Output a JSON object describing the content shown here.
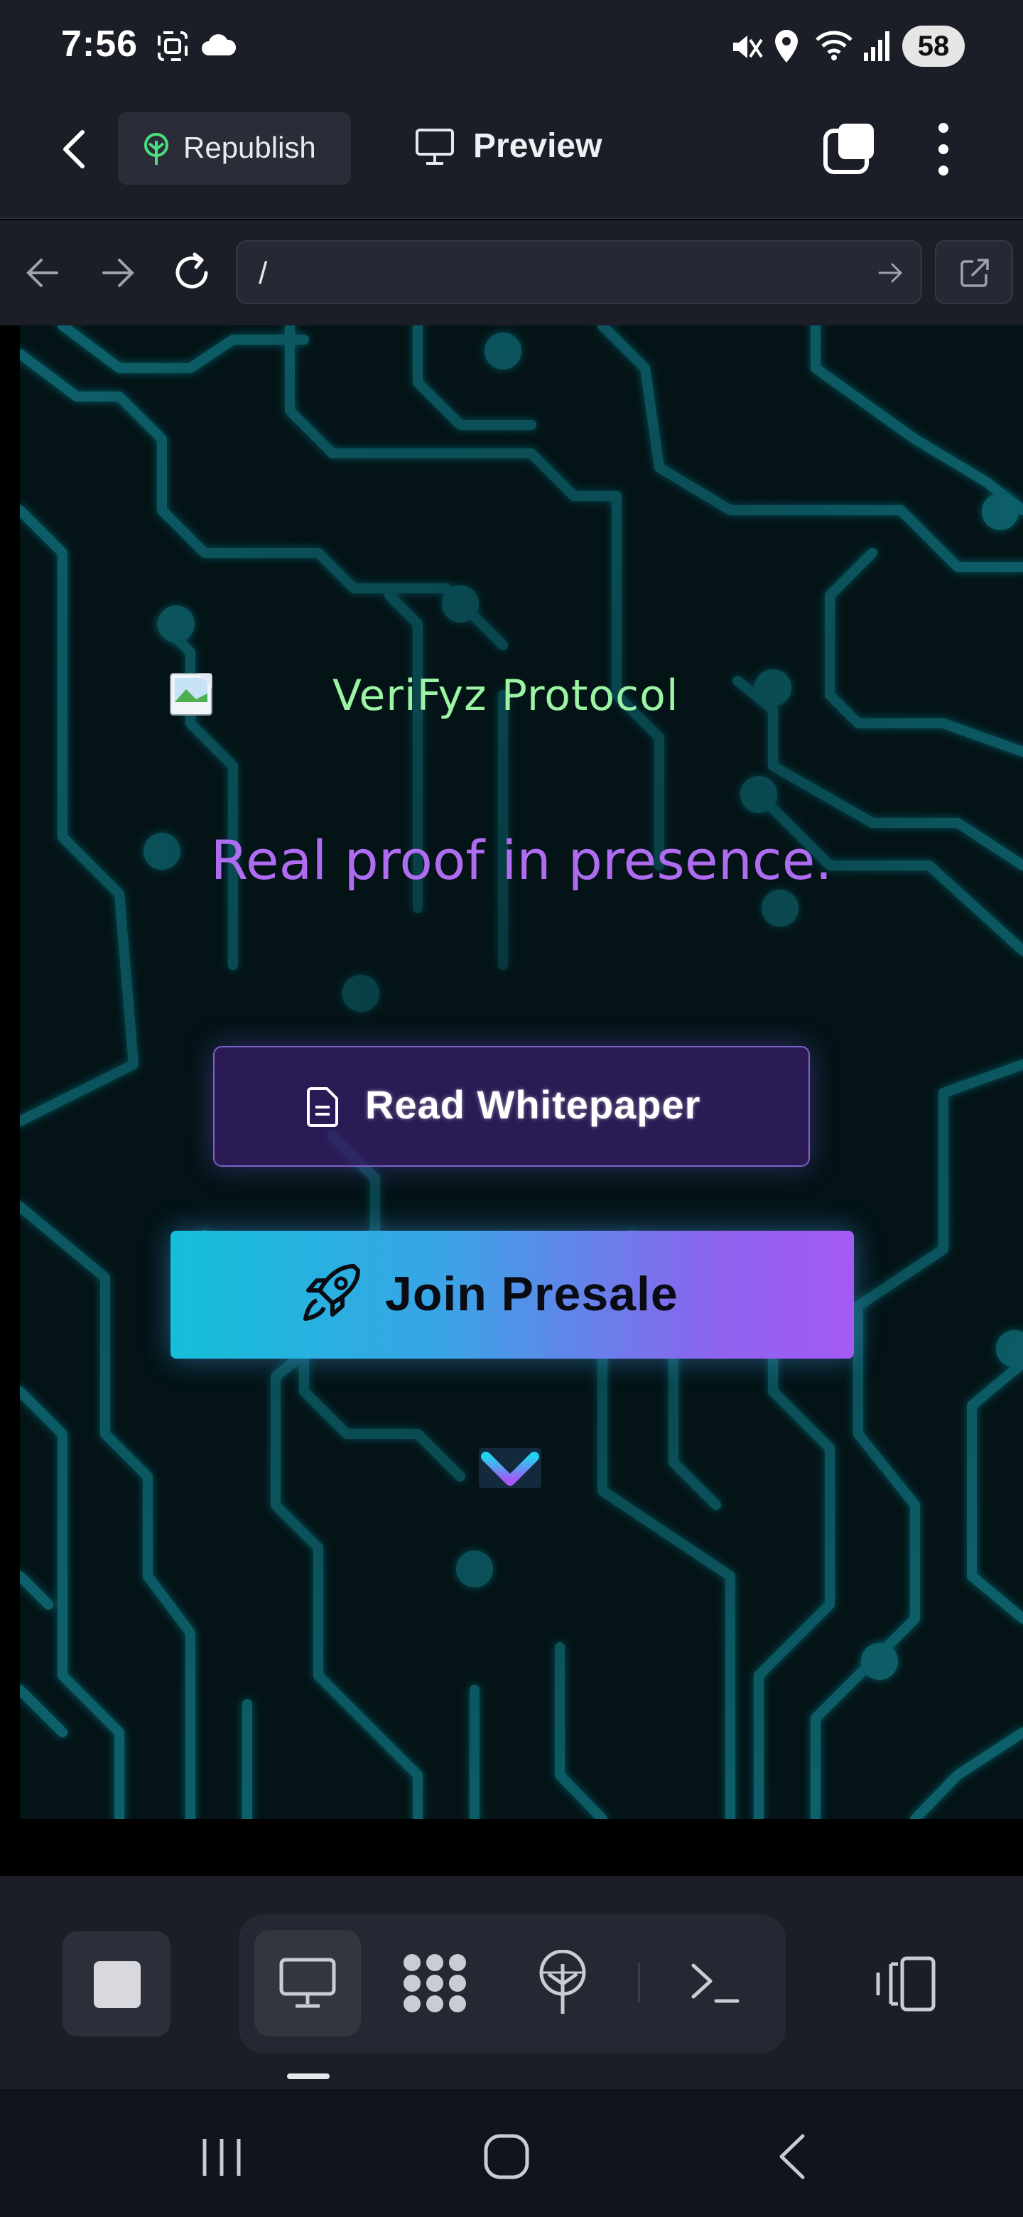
{
  "status_bar": {
    "time": "7:56",
    "battery": "58",
    "icons": [
      "screenshot-icon",
      "cloud-icon",
      "mute-icon",
      "location-icon",
      "wifi-icon",
      "signal-icon"
    ]
  },
  "header": {
    "republish_label": "Republish",
    "preview_label": "Preview"
  },
  "browser": {
    "url": "/"
  },
  "site": {
    "brand": "VeriFyz Protocol",
    "tagline": "Real proof in presence.",
    "whitepaper_label": "Read Whitepaper",
    "presale_label": "Join Presale"
  },
  "colors": {
    "background": "#031316",
    "circuit": "#0d5d66",
    "brand": "#9bf3a3",
    "tagline": "#b06cf0",
    "accent_start": "#14bfd8",
    "accent_end": "#a55af5"
  },
  "bottom_bar": {
    "tabs": [
      "desktop-icon",
      "apps-icon",
      "deploy-icon",
      "terminal-icon"
    ]
  }
}
